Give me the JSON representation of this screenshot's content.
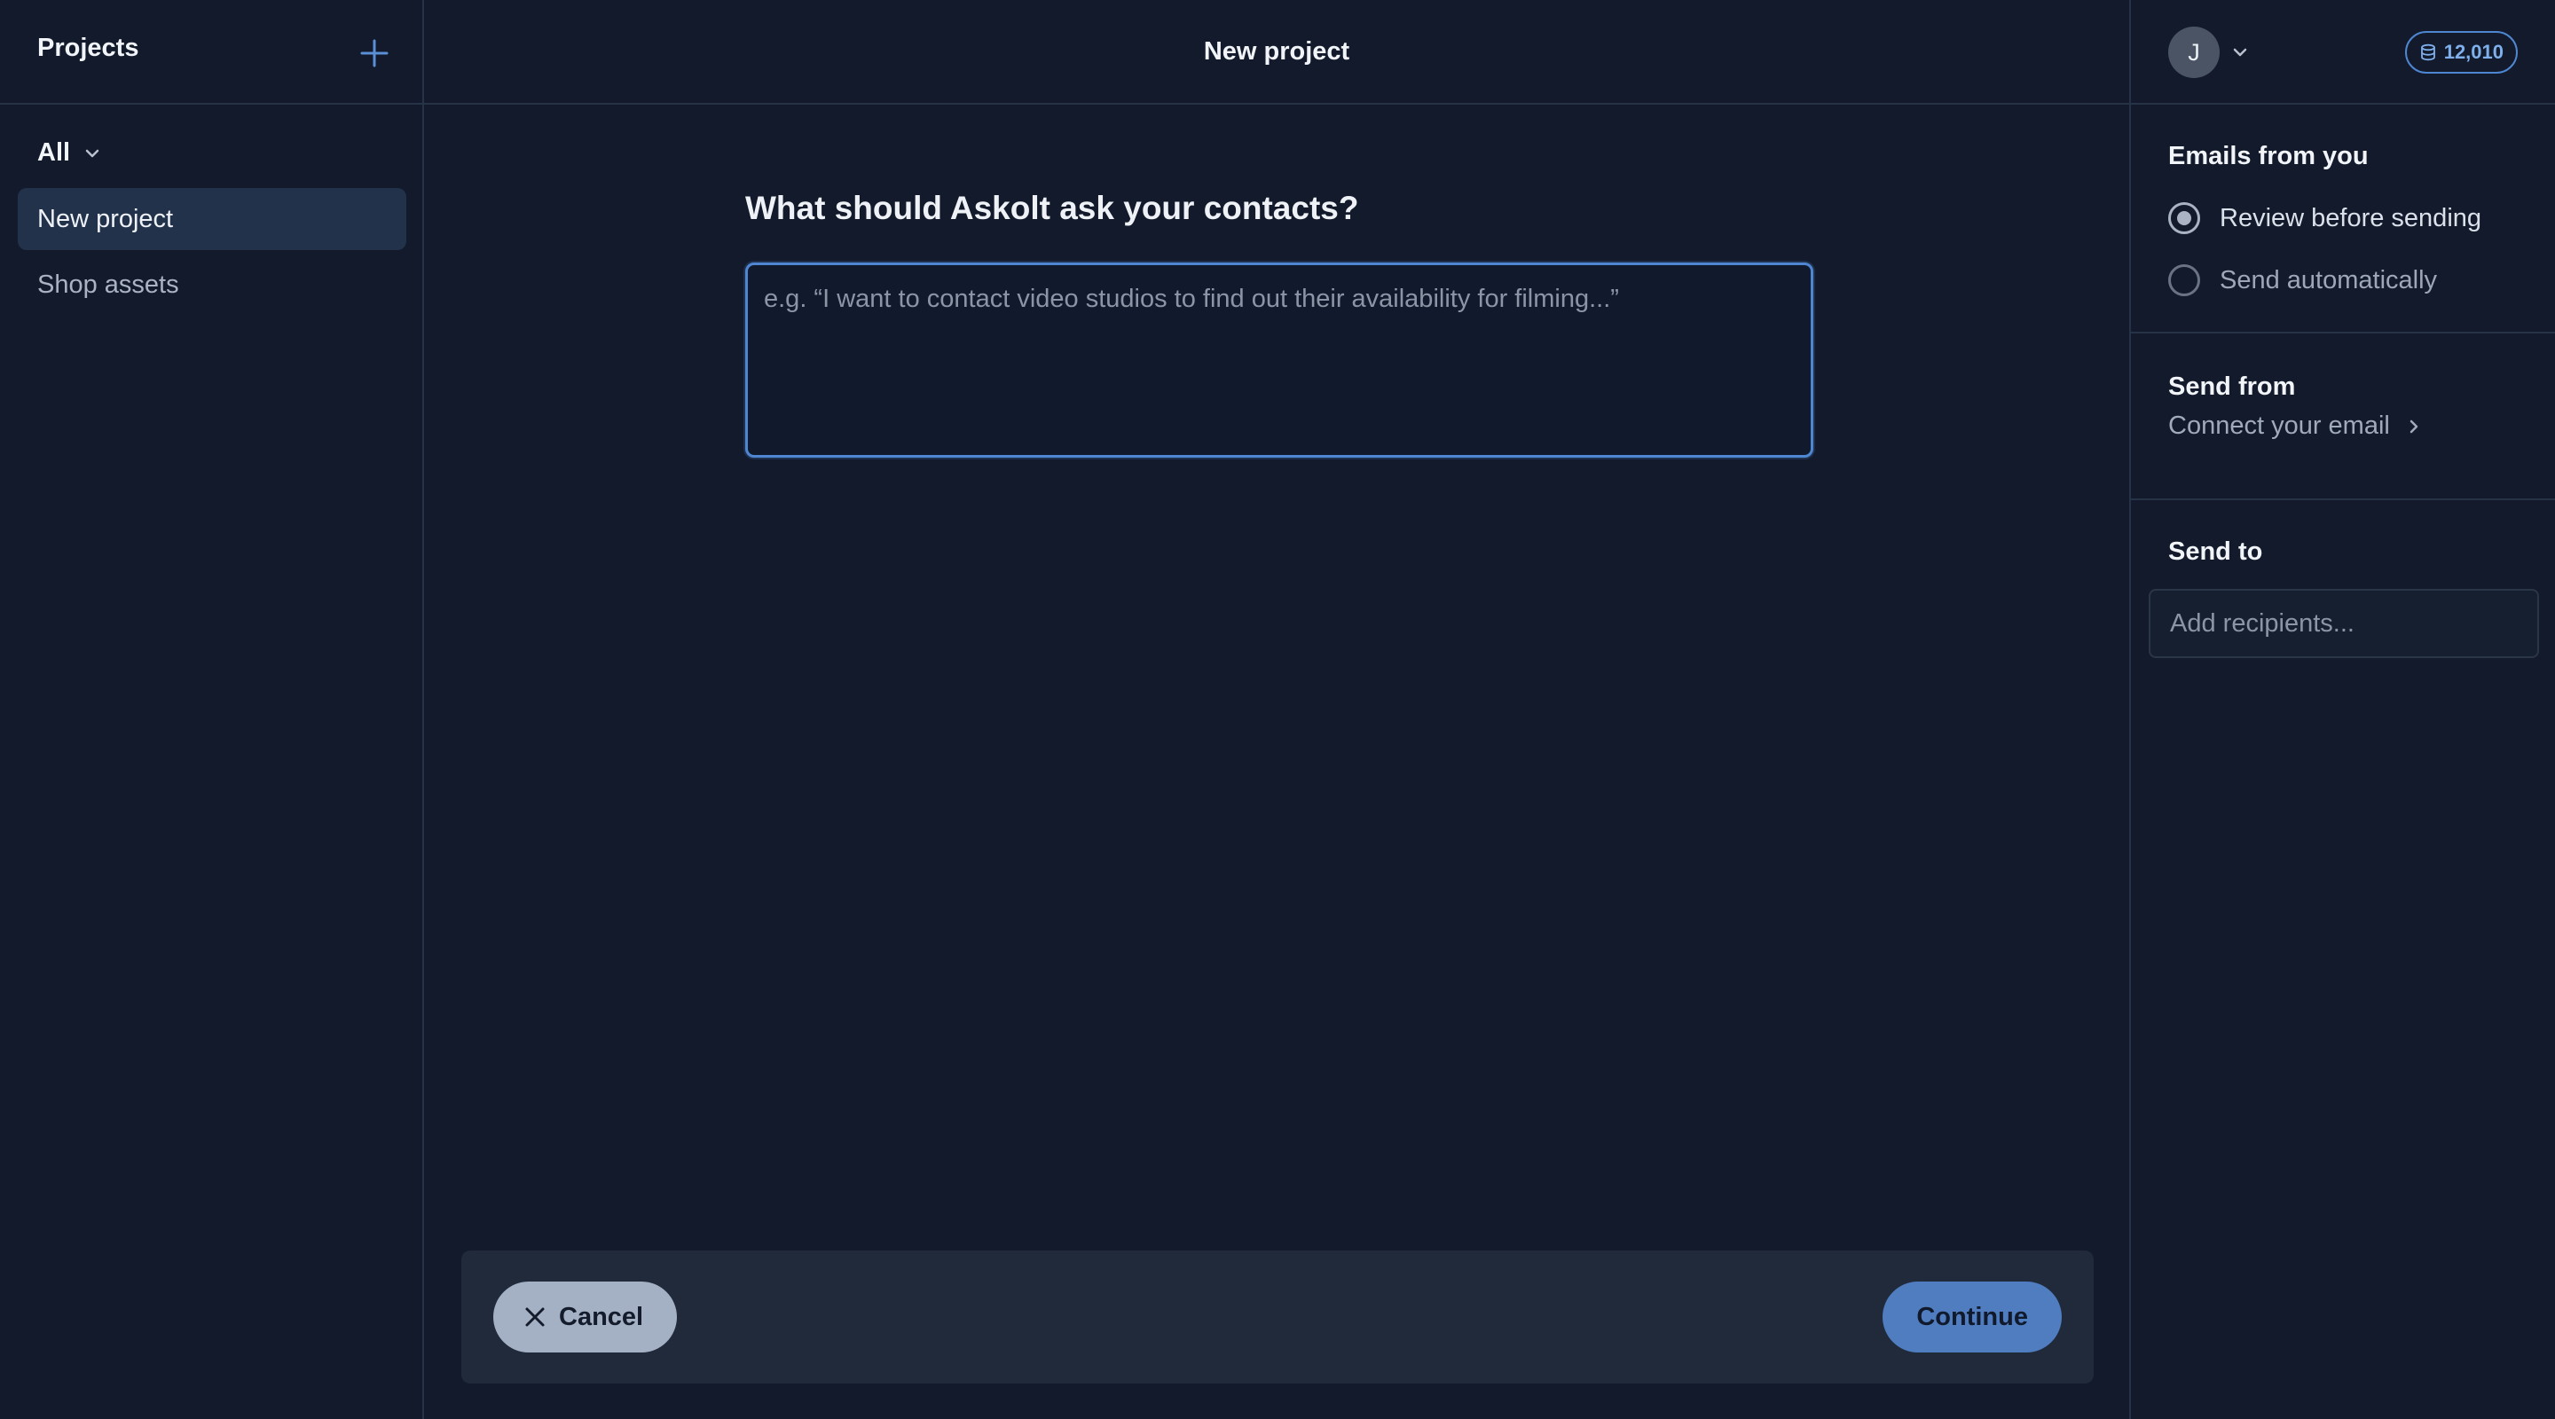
{
  "sidebar": {
    "title": "Projects",
    "filter_label": "All",
    "projects": [
      {
        "label": "New project",
        "active": true
      },
      {
        "label": "Shop assets",
        "active": false
      }
    ]
  },
  "header": {
    "title": "New project"
  },
  "main": {
    "question": "What should Askolt ask your contacts?",
    "prompt_placeholder": "e.g. “I want to contact video studios to find out their availability for filming...”",
    "prompt_value": ""
  },
  "footer": {
    "cancel_label": "Cancel",
    "continue_label": "Continue"
  },
  "account": {
    "avatar_initial": "J",
    "credits": "12,010"
  },
  "settings": {
    "emails_title": "Emails from you",
    "email_modes": [
      {
        "label": "Review before sending",
        "selected": true
      },
      {
        "label": "Send automatically",
        "selected": false
      }
    ],
    "send_from_title": "Send from",
    "connect_email_label": "Connect your email",
    "send_to_title": "Send to",
    "recipients_placeholder": "Add recipients..."
  },
  "icons": {
    "add": "plus-icon",
    "filter_toggle": "chevron-down-icon",
    "cancel": "close-icon",
    "credits": "database-icon",
    "connect": "chevron-right-icon"
  },
  "colors": {
    "background": "#121a2b",
    "accent": "#4f86d1",
    "continue_button": "#4f7dc0",
    "cancel_button": "#a4b1c5",
    "active_item": "#23324b"
  }
}
